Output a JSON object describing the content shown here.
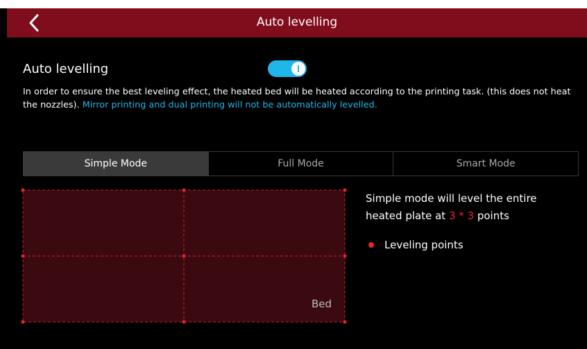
{
  "header": {
    "title": "Auto levelling",
    "back_icon": "chevron-left-icon"
  },
  "auto_levelling": {
    "label": "Auto levelling",
    "enabled": true,
    "description": "In order to ensure the best leveling effect, the heated bed will be heated according to the printing task. (this does not heat the nozzles).",
    "note": "Mirror printing and dual printing will not be automatically levelled."
  },
  "modes": {
    "selected": "Simple Mode",
    "items": [
      {
        "label": "Simple Mode"
      },
      {
        "label": "Full Mode"
      },
      {
        "label": "Smart Mode"
      }
    ]
  },
  "bed": {
    "label": "Bed",
    "grid_points": "3 * 3"
  },
  "info": {
    "text_before": "Simple mode will level the entire heated plate at",
    "grid": "3 * 3",
    "text_after": "points"
  },
  "legend": {
    "label": "Leveling points"
  },
  "colors": {
    "header_bg": "#7f0d1c",
    "accent_blue": "#1fb6ea",
    "point_red": "#e8242c",
    "bed_fill": "#3b0a10",
    "active_tab_bg": "#3a3a3a"
  }
}
